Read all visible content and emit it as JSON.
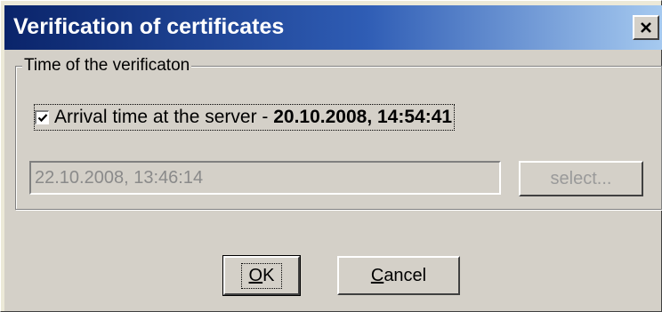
{
  "window": {
    "title": "Verification of certificates",
    "close_icon": "close-icon"
  },
  "group": {
    "legend": "Time of the verificaton"
  },
  "checkbox": {
    "checked": true,
    "label_prefix": "Arrival time at the server - ",
    "label_value": "20.10.2008, 14:54:41"
  },
  "date_field": {
    "value": "22.10.2008, 13:46:14",
    "disabled": true
  },
  "select_button": {
    "label": "select...",
    "disabled": true
  },
  "buttons": {
    "ok": {
      "mnemonic": "O",
      "rest": "K"
    },
    "cancel": {
      "mnemonic": "C",
      "rest": "ancel"
    }
  },
  "colors": {
    "title_gradient_start": "#0a246a",
    "title_gradient_end": "#a6caf0",
    "face": "#d4d0c8",
    "disabled_text": "#8a8a8a"
  }
}
